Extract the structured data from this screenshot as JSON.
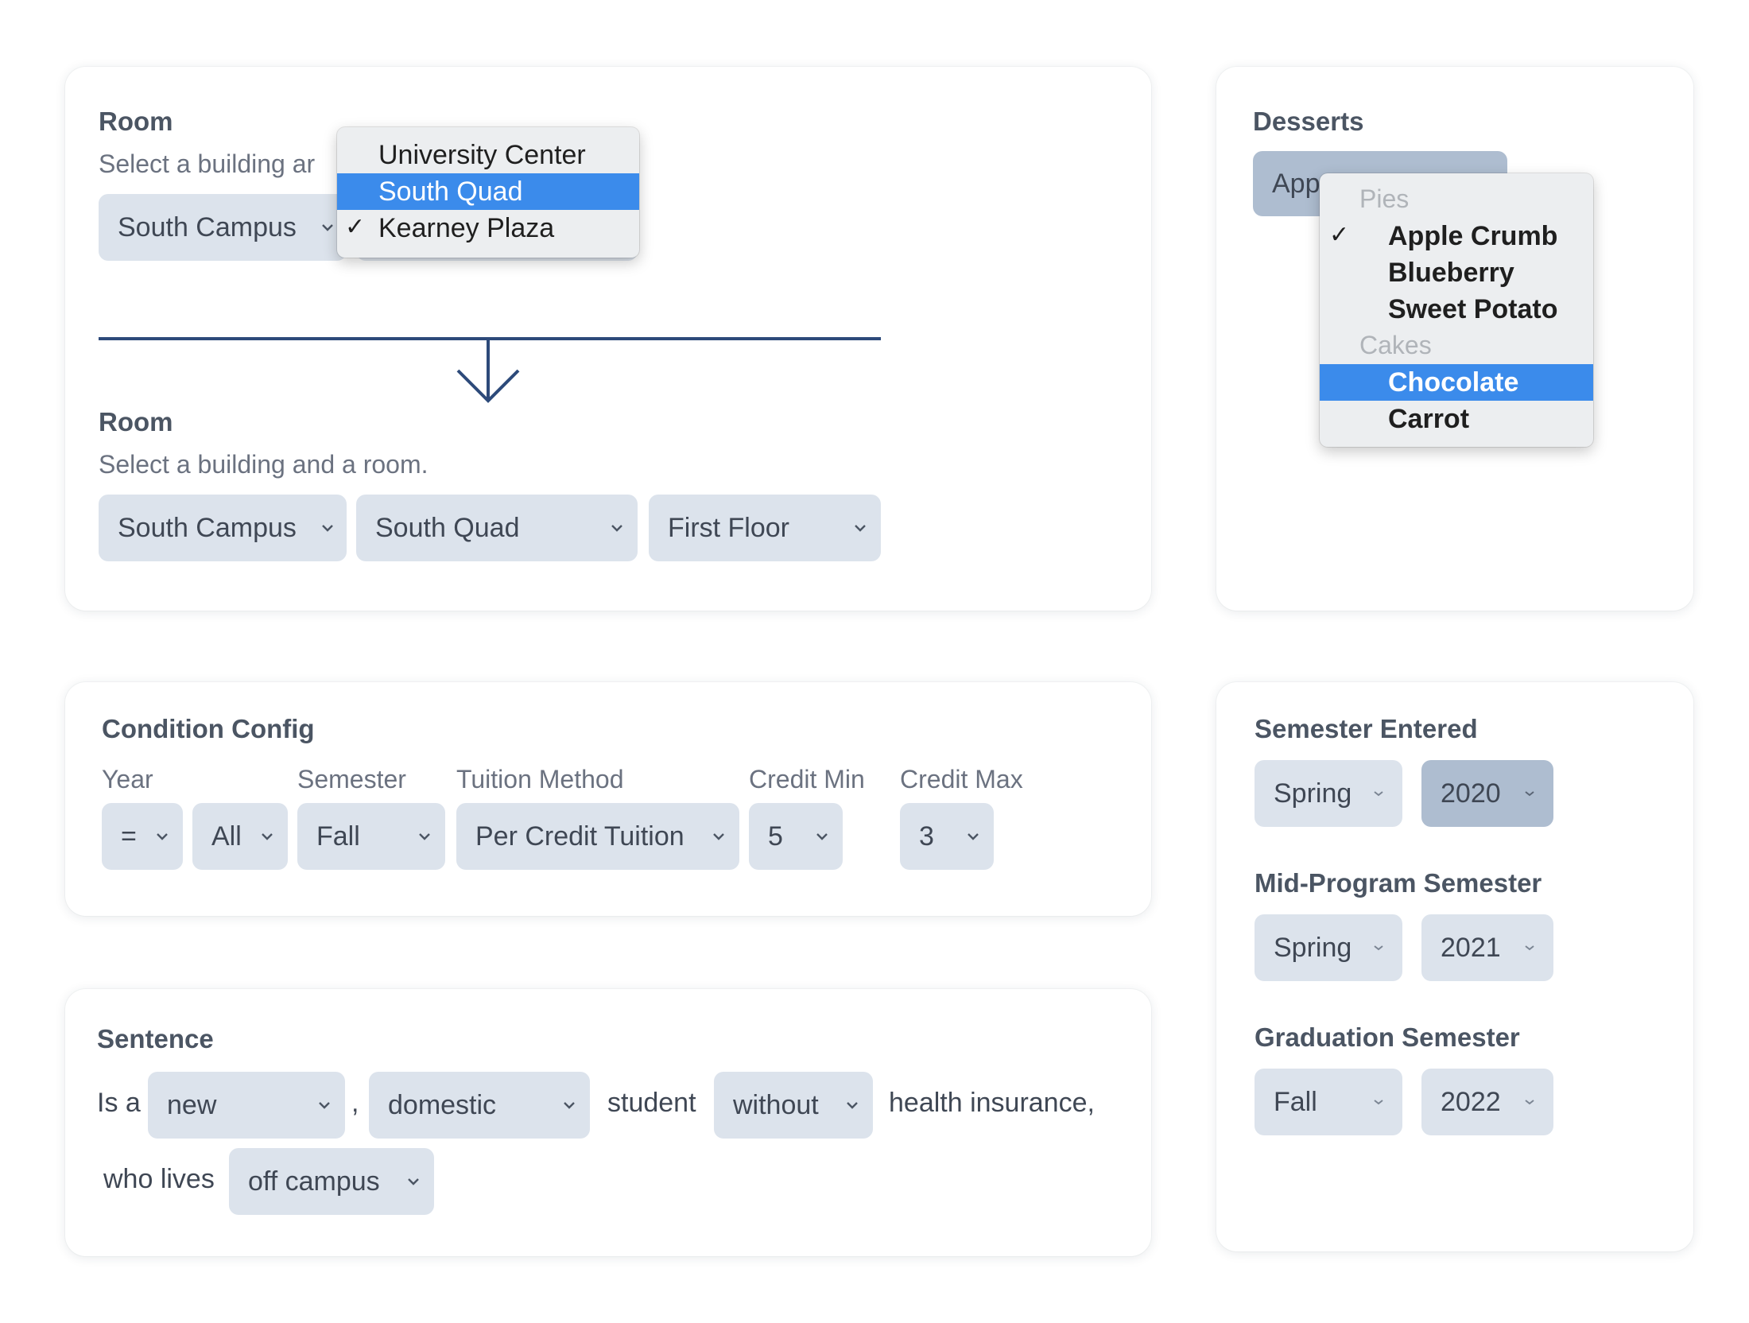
{
  "room_card": {
    "title": "Room",
    "hint_partial": "Select a building ar",
    "campus_select": "South Campus",
    "menu": {
      "items": [
        "University Center",
        "South Quad",
        "Kearney Plaza"
      ],
      "highlighted": "South Quad",
      "checked": "Kearney Plaza",
      "check_mark": "✓"
    },
    "result_title": "Room",
    "result_hint": "Select a building and a room.",
    "result_selects": [
      "South Campus",
      "South Quad",
      "First Floor"
    ]
  },
  "desserts_card": {
    "title": "Desserts",
    "select_partial": "App",
    "menu": {
      "groups": [
        {
          "label": "Pies",
          "items": [
            "Apple Crumb",
            "Blueberry",
            "Sweet Potato"
          ]
        },
        {
          "label": "Cakes",
          "items": [
            "Chocolate",
            "Carrot"
          ]
        }
      ],
      "checked": "Apple Crumb",
      "highlighted": "Chocolate",
      "check_mark": "✓"
    }
  },
  "condition_card": {
    "title": "Condition Config",
    "labels": {
      "year": "Year",
      "semester": "Semester",
      "tuition": "Tuition Method",
      "credit_min": "Credit Min",
      "credit_max": "Credit Max"
    },
    "values": {
      "year_op": "=",
      "year": "All",
      "semester": "Fall",
      "tuition": "Per Credit Tuition",
      "credit_min": "5",
      "credit_max": "3"
    }
  },
  "sentence_card": {
    "title": "Sentence",
    "parts": {
      "is_a": "Is a",
      "type": "new",
      "comma": ",",
      "origin": "domestic",
      "student": "student",
      "insurance": "without",
      "health": "health insurance,",
      "who_lives": "who lives",
      "residence": "off campus"
    }
  },
  "semester_card": {
    "entered": {
      "title": "Semester Entered",
      "term": "Spring",
      "year": "2020"
    },
    "mid": {
      "title": "Mid-Program Semester",
      "term": "Spring",
      "year": "2021"
    },
    "graduation": {
      "title": "Graduation Semester",
      "term": "Fall",
      "year": "2022"
    }
  },
  "colors": {
    "select_bg": "#dce3ec",
    "select_bg_active": "#aebdd0",
    "menu_highlight": "#3b8beb",
    "arrow": "#2d4a7a"
  }
}
